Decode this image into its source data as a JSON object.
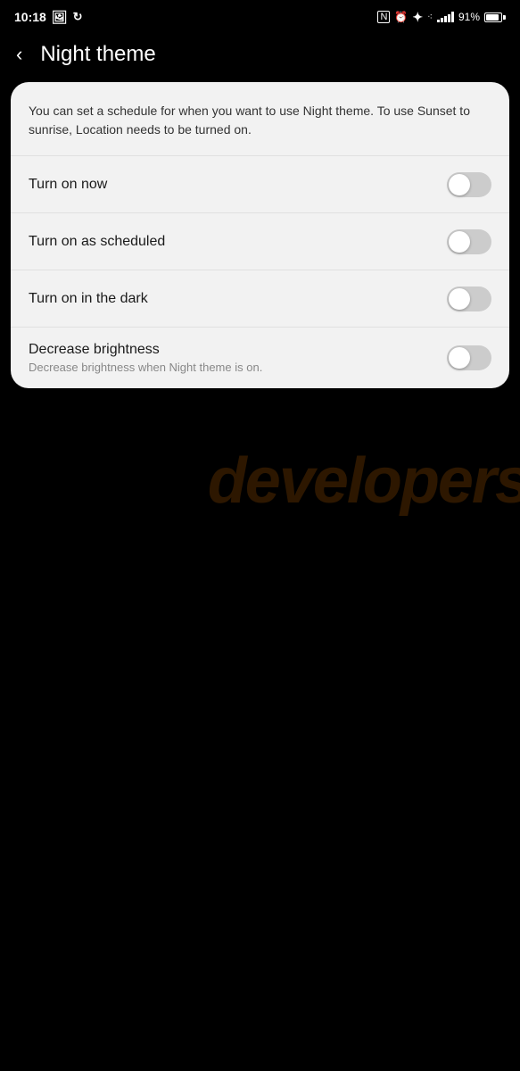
{
  "statusBar": {
    "time": "10:18",
    "battery": "91%",
    "icons": {
      "notification": "N",
      "alarm": "⏰",
      "bluetooth": "✦",
      "signal": "signal",
      "battery": "battery"
    }
  },
  "header": {
    "backLabel": "‹",
    "title": "Night theme"
  },
  "infoText": "You can set a schedule for when you want to use Night theme. To use Sunset to sunrise, Location needs to be turned on.",
  "settings": [
    {
      "id": "turn-on-now",
      "label": "Turn on now",
      "sublabel": "",
      "toggled": false
    },
    {
      "id": "turn-on-scheduled",
      "label": "Turn on as scheduled",
      "sublabel": "",
      "toggled": false
    },
    {
      "id": "turn-on-dark",
      "label": "Turn on in the dark",
      "sublabel": "",
      "toggled": false
    },
    {
      "id": "decrease-brightness",
      "label": "Decrease brightness",
      "sublabel": "Decrease brightness when Night theme is on.",
      "toggled": false
    }
  ],
  "watermark": "developers"
}
